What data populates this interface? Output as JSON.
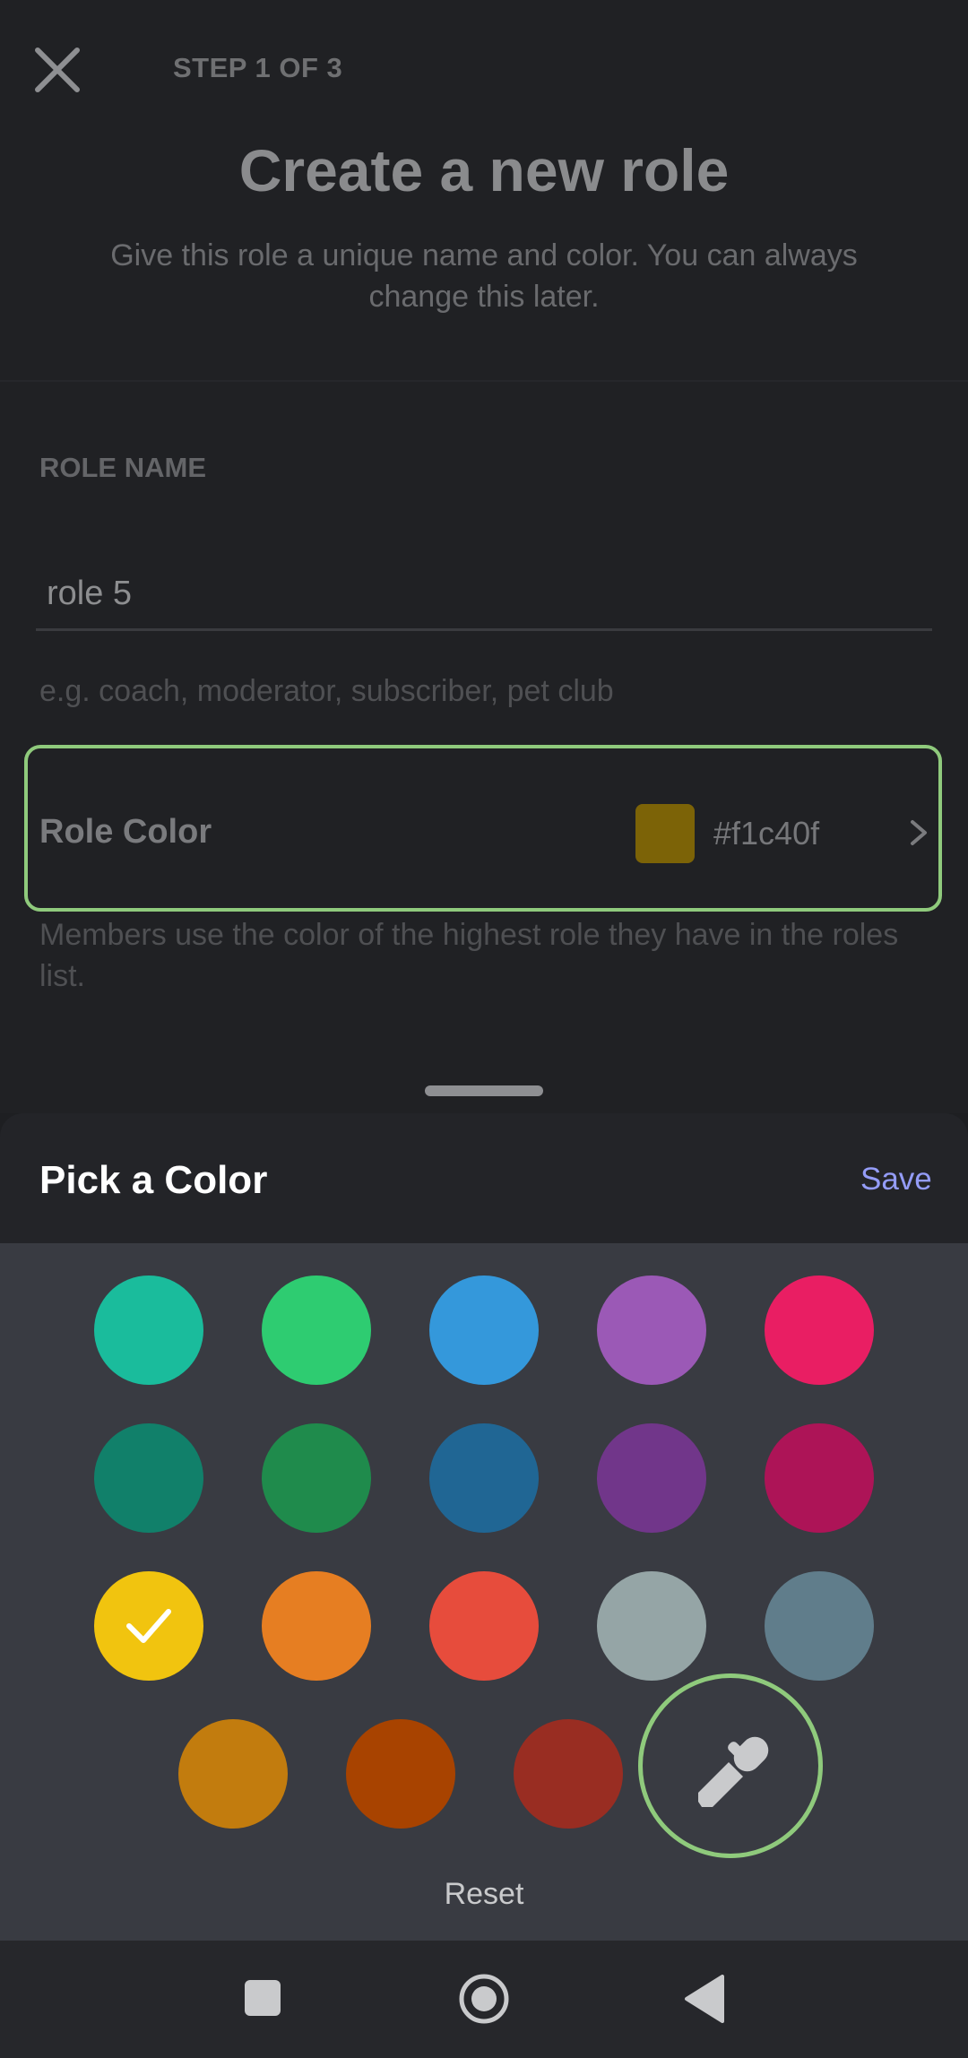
{
  "header": {
    "step": "STEP 1 OF 3",
    "title": "Create a new role",
    "subtitle": "Give this role a unique name and color. You can always change this later."
  },
  "role_name": {
    "label": "ROLE NAME",
    "value": "role 5",
    "hint": "e.g. coach, moderator, subscriber, pet club"
  },
  "role_color": {
    "label": "Role Color",
    "hex": "#f1c40f",
    "swatch_color": "#7c6307",
    "description": "Members use the color of the highest role they have in the roles list."
  },
  "color_picker": {
    "title": "Pick a Color",
    "save_label": "Save",
    "reset_label": "Reset",
    "selected": "#f1c40f",
    "swatches": [
      "#1abc9c",
      "#2ecc71",
      "#3498db",
      "#9b59b6",
      "#e91e63",
      "#11806a",
      "#1f8b4c",
      "#206694",
      "#71368a",
      "#ad1457",
      "#f1c40f",
      "#e67e22",
      "#e74c3c",
      "#95a5a6",
      "#607d8b",
      "#c27c0e",
      "#a84300",
      "#992d22"
    ],
    "custom_icon": "eyedropper-icon"
  },
  "icons": {
    "close": "close-icon",
    "chevron": "chevron-right-icon",
    "check": "checkmark-icon"
  },
  "navbar": {
    "recents": "square-icon",
    "home": "circle-home-icon",
    "back": "triangle-back-icon"
  }
}
